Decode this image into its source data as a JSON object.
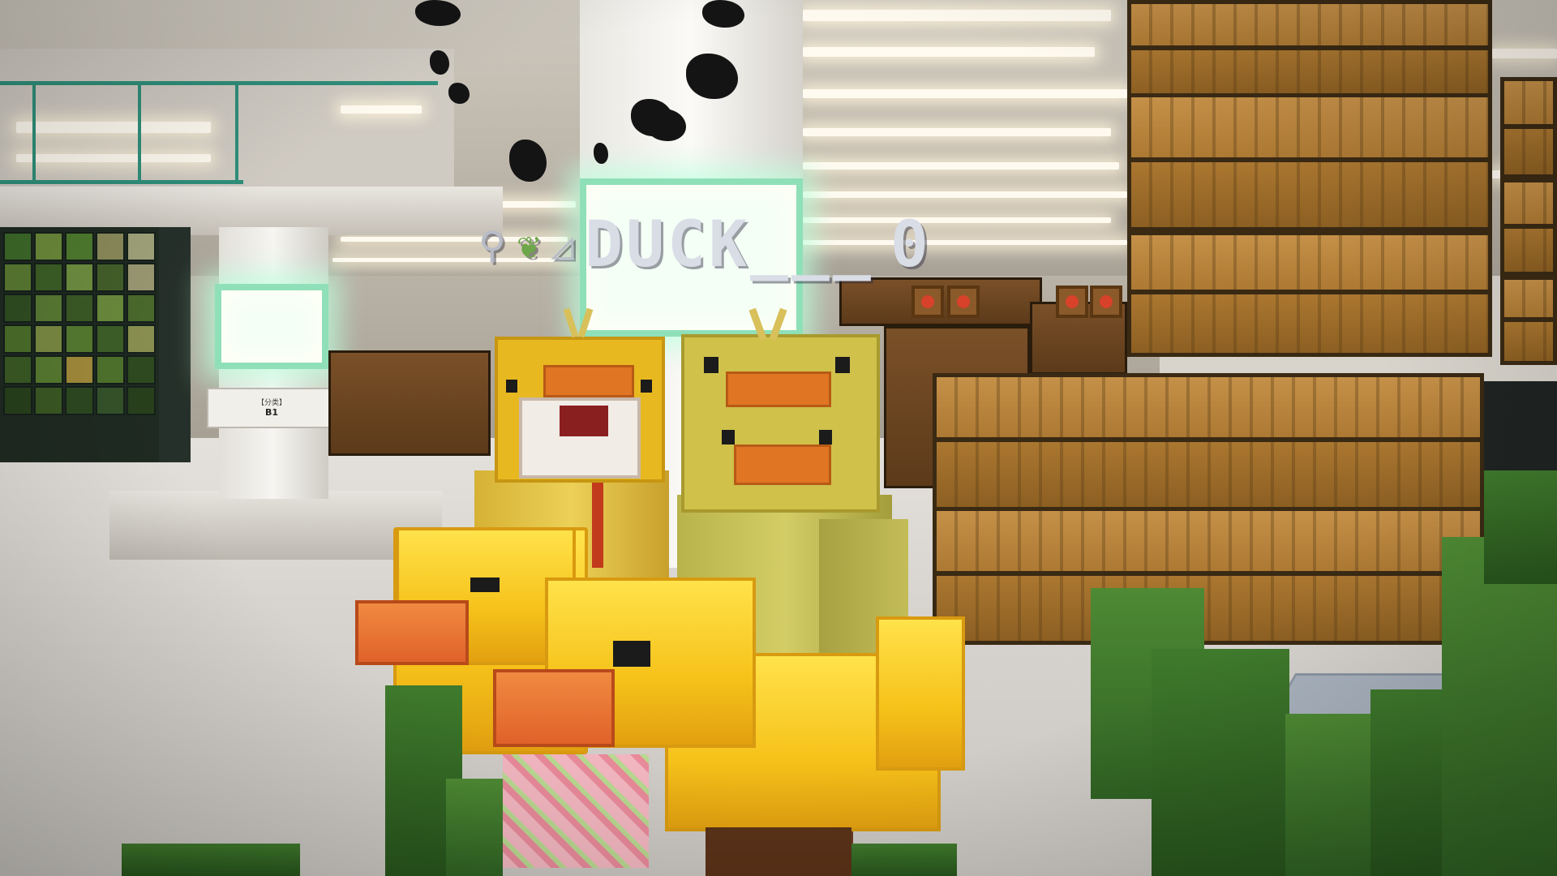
{
  "nameplate": {
    "left_icon": "fishing-rod-icon",
    "left_icon_glyph": "⚲",
    "leaf_icon": "leaf-icon",
    "leaf_icon_glyph": "❦",
    "badge_icon": "flag-badge-icon",
    "badge_glyph": "◿",
    "player_name": "DUCK___",
    "score": "0"
  },
  "signs": {
    "floor_sign_top": "【分类】",
    "floor_sign_label": "B1"
  },
  "colors": {
    "lamp_glow": "#8fe0b8",
    "duck_yellow": "#f6c21a",
    "beak_orange": "#e0622a",
    "crate_wood": "#a8752f",
    "leaf_green": "#3f7a2c"
  }
}
